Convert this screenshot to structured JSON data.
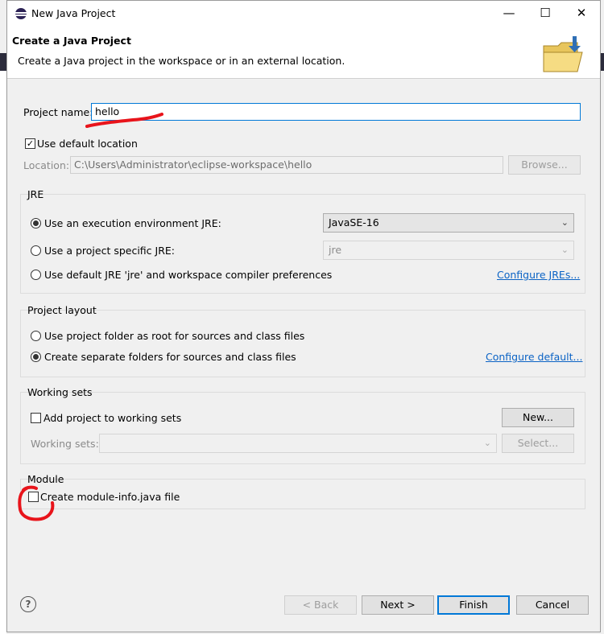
{
  "window": {
    "title": "New Java Project",
    "controls": [
      "—",
      "☐",
      "✕"
    ]
  },
  "header": {
    "title": "Create a Java Project",
    "description": "Create a Java project in the workspace or in an external location."
  },
  "project": {
    "name_label": "Project name:",
    "name_value": "hello",
    "use_default_location_label": "Use default location",
    "use_default_location_checked": true,
    "location_label": "Location:",
    "location_value": "C:\\Users\\Administrator\\eclipse-workspace\\hello",
    "browse_label": "Browse..."
  },
  "jre": {
    "title": "JRE",
    "exec_env_label": "Use an execution environment JRE:",
    "exec_env_value": "JavaSE-16",
    "project_specific_label": "Use a project specific JRE:",
    "project_specific_value": "jre",
    "default_label": "Use default JRE 'jre' and workspace compiler preferences",
    "configure_link": "Configure JREs..."
  },
  "layout": {
    "title": "Project layout",
    "root_label": "Use project folder as root for sources and class files",
    "separate_label": "Create separate folders for sources and class files",
    "configure_link": "Configure default..."
  },
  "working_sets": {
    "title": "Working sets",
    "add_label": "Add project to working sets",
    "new_label": "New...",
    "sets_label": "Working sets:",
    "select_label": "Select..."
  },
  "module": {
    "title": "Module",
    "create_label": "Create module-info.java file"
  },
  "footer": {
    "back_label": "< Back",
    "next_label": "Next >",
    "finish_label": "Finish",
    "cancel_label": "Cancel",
    "help_glyph": "?"
  },
  "colors": {
    "accent": "#0078d7",
    "link": "#0b63c5",
    "annotation_red": "#e8141b"
  }
}
